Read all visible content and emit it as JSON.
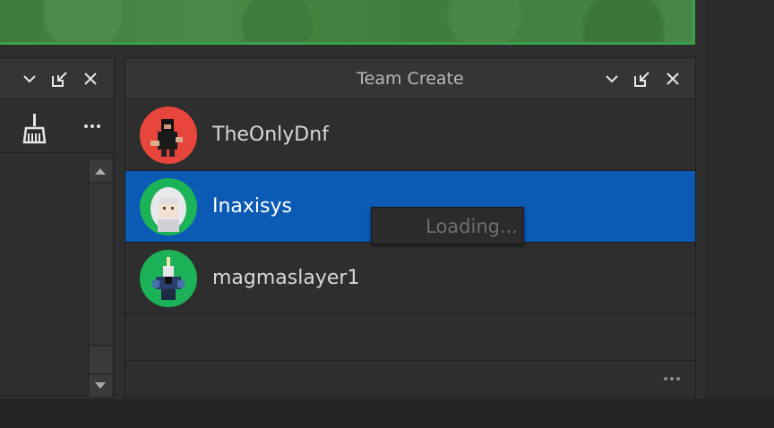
{
  "team_create": {
    "title": "Team Create",
    "users": [
      {
        "name": "TheOnlyDnf",
        "avatar_bg": "#e8453c",
        "selected": false
      },
      {
        "name": "Inaxisys",
        "avatar_bg": "#1cb257",
        "selected": true
      },
      {
        "name": "magmaslayer1",
        "avatar_bg": "#1cb257",
        "selected": false
      }
    ],
    "more_icon": "ellipsis-icon"
  },
  "tooltip": {
    "text": "Loading..."
  },
  "colors": {
    "selection": "#0b5ab4",
    "panel_bg": "#2e2e2e",
    "header_bg": "#353535",
    "viewport_border": "#3aa049"
  },
  "icons": {
    "collapse": "chevron-down-icon",
    "dock": "undock-icon",
    "close": "close-icon",
    "clean": "broom-icon",
    "more": "ellipsis-icon"
  }
}
